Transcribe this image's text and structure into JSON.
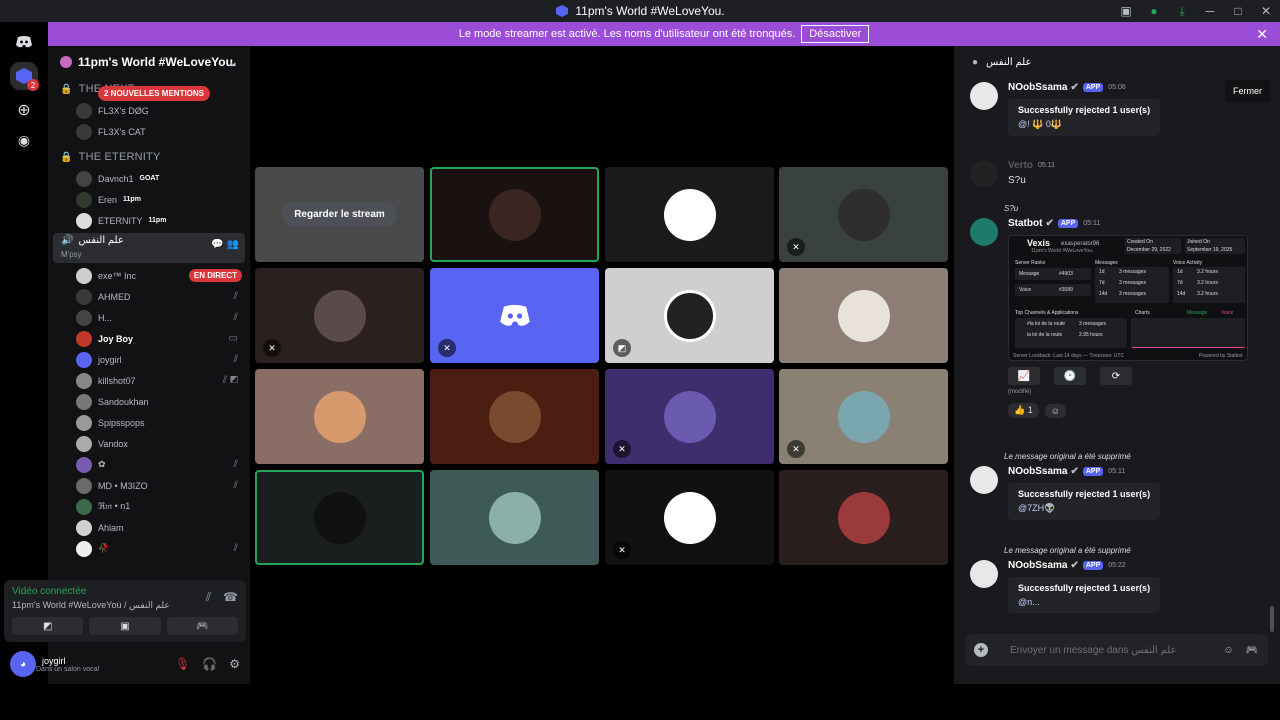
{
  "window": {
    "title": "11pm's World #WeLoveYou."
  },
  "banner": {
    "text": "Le mode streamer est activé. Les noms d'utilisateur ont été tronqués.",
    "button": "Désactiver"
  },
  "rail": {
    "badge": "2"
  },
  "sidebar": {
    "server_name": "11pm's World #WeLoveYou.",
    "mentions_badge": "2 NOUVELLES MENTIONS",
    "categories": [
      {
        "name": "THE NEXT",
        "users": [
          "FL3X's DØG",
          "FL3X's CAT"
        ]
      },
      {
        "name": "THE ETERNITY",
        "users": [
          "Davnch1",
          "Eren",
          "ETERNITY"
        ]
      }
    ],
    "user_tags": {
      "davnch": "GOAT",
      "eren": "11pm",
      "eternity": "11pm"
    },
    "active_channel": {
      "name": "علم النفس",
      "sub": "M'psy"
    },
    "voice_users": [
      {
        "name": "exe™ Inc",
        "live": "EN DIRECT"
      },
      {
        "name": "AHMED"
      },
      {
        "name": "H..."
      },
      {
        "name": "Joy Boy"
      },
      {
        "name": "joygirl"
      },
      {
        "name": "killshot07"
      },
      {
        "name": "Sandoukhan"
      },
      {
        "name": "Spipsspops"
      },
      {
        "name": "Vandox"
      },
      {
        "name": "✿"
      },
      {
        "name": "MD • M3IZO"
      },
      {
        "name": "ℜ𝔪 • n1"
      },
      {
        "name": "Ahlam"
      },
      {
        "name": "🥀"
      }
    ],
    "voice_panel": {
      "status": "Vidéo connectée",
      "channel": "11pm's World #WeLoveYou / علم النفس"
    },
    "user": {
      "name": "joygirl",
      "status": "Dans un salon vocal"
    }
  },
  "stage": {
    "watch_button": "Regarder le stream"
  },
  "chat": {
    "channel_name": "علم النفس",
    "close_tooltip": "Fermer",
    "messages": [
      {
        "author": "NOobSsama",
        "tag": "APP",
        "time": "05:06",
        "embed_title": "Successfully rejected 1 user(s)",
        "embed_line": "@! 🔱 0🔱"
      },
      {
        "author": "Verto",
        "time": "05:11",
        "text": "S?u"
      },
      {
        "author": "Statbot",
        "tag": "APP",
        "time": "05:11",
        "reply": "S?u"
      },
      {
        "author": "NOobSsama",
        "tag": "APP",
        "time": "05:11",
        "reply": "Le message original a été supprimé",
        "embed_title": "Successfully rejected 1 user(s)",
        "embed_line": "@7ZH👽"
      },
      {
        "author": "NOobSsama",
        "tag": "APP",
        "time": "05:22",
        "reply": "Le message original a été supprimé",
        "embed_title": "Successfully rejected 1 user(s)",
        "embed_line": "@n..."
      }
    ],
    "statbot_card": {
      "user": "Vexis",
      "handle": "exasperator96",
      "server": "11pm's World #WeLoveYou.",
      "created_label": "Created On",
      "created": "December 29, 2022",
      "joined_label": "Joined On",
      "joined": "September 19, 2025",
      "ranks_title": "Server Ranks",
      "rank_rows": [
        [
          "Message",
          "#4903"
        ],
        [
          "Voice",
          "#3089"
        ]
      ],
      "messages_title": "Messages",
      "message_rows": [
        [
          "1d",
          "3 messages"
        ],
        [
          "7d",
          "3 messages"
        ],
        [
          "14d",
          "3 messages"
        ]
      ],
      "voice_title": "Voice Activity",
      "voice_rows": [
        [
          "1d",
          "3.2 hours"
        ],
        [
          "7d",
          "3.2 hours"
        ],
        [
          "14d",
          "3.2 hours"
        ]
      ],
      "top_title": "Top Channels & Applications",
      "top_rows": [
        [
          "#la loi de la route",
          "3 messages"
        ],
        [
          "la loi de la route",
          "2.95 hours"
        ]
      ],
      "charts_title": "Charts",
      "charts_legend": [
        "Message",
        "Voice"
      ],
      "footer": "Server Lookback: Last 14 days — Timezone: UTC",
      "powered": "Powered by Statbot"
    },
    "edited": "(modifié)",
    "reaction": {
      "emoji": "👍",
      "count": "1"
    },
    "input_placeholder": "Envoyer un message dans علم النفس"
  }
}
